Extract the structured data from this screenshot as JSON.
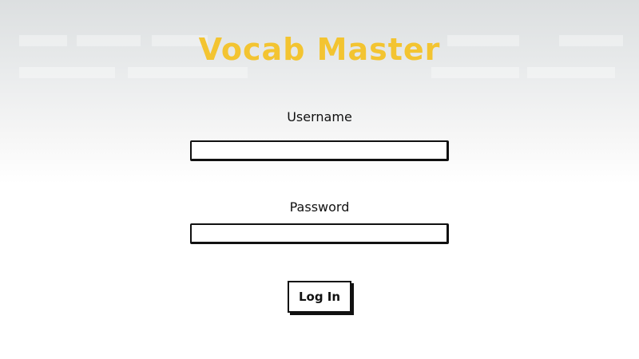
{
  "app": {
    "title": "Vocab Master",
    "accent_color": "#f3c431"
  },
  "login_form": {
    "username_label": "Username",
    "username_value": "",
    "password_label": "Password",
    "password_value": "",
    "submit_label": "Log In"
  }
}
